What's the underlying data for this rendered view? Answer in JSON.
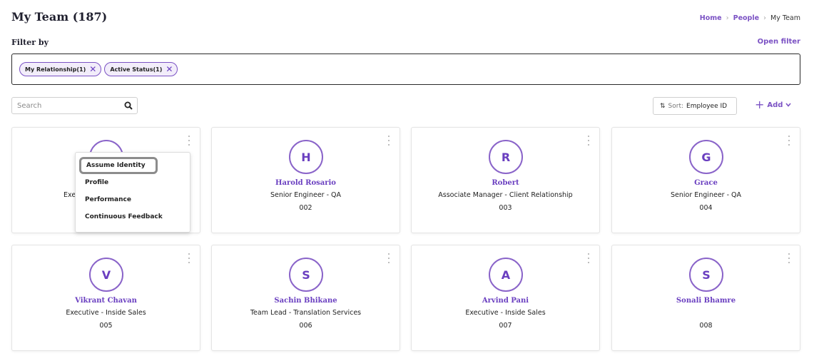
{
  "page": {
    "title": "My Team (187)",
    "breadcrumb": [
      {
        "label": "Home"
      },
      {
        "label": "People"
      },
      {
        "label": "My Team"
      }
    ]
  },
  "filter": {
    "label": "Filter by",
    "open_label": "Open filter",
    "chips": [
      {
        "label": "My Relationship(1)"
      },
      {
        "label": "Active Status(1)"
      }
    ]
  },
  "toolbar": {
    "search_placeholder": "Search",
    "sort_prefix": "Sort:",
    "sort_value": "Employee ID",
    "add_label": "Add"
  },
  "cards": [
    {
      "initial": "",
      "name": "",
      "role": "Exec",
      "emp_id": ""
    },
    {
      "initial": "H",
      "name": "Harold Rosario",
      "role": "Senior Engineer - QA",
      "emp_id": "002"
    },
    {
      "initial": "R",
      "name": "Robert",
      "role": "Associate Manager - Client Relationship",
      "emp_id": "003"
    },
    {
      "initial": "G",
      "name": "Grace",
      "role": "Senior Engineer - QA",
      "emp_id": "004"
    },
    {
      "initial": "V",
      "name": "Vikrant Chavan",
      "role": "Executive - Inside Sales",
      "emp_id": "005"
    },
    {
      "initial": "S",
      "name": "Sachin Bhikane",
      "role": "Team Lead - Translation Services",
      "emp_id": "006"
    },
    {
      "initial": "A",
      "name": "Arvind Pani",
      "role": "Executive - Inside Sales",
      "emp_id": "007"
    },
    {
      "initial": "S",
      "name": "Sonali Bhamre",
      "role": "",
      "emp_id": "008"
    }
  ],
  "context_menu": {
    "items": [
      {
        "label": "Assume Identity"
      },
      {
        "label": "Profile"
      },
      {
        "label": "Performance"
      },
      {
        "label": "Continuous Feedback"
      }
    ]
  },
  "colors": {
    "accent": "#7b52c4",
    "accent_dark": "#6a3fc0",
    "chip_bg": "#f2edfa"
  }
}
